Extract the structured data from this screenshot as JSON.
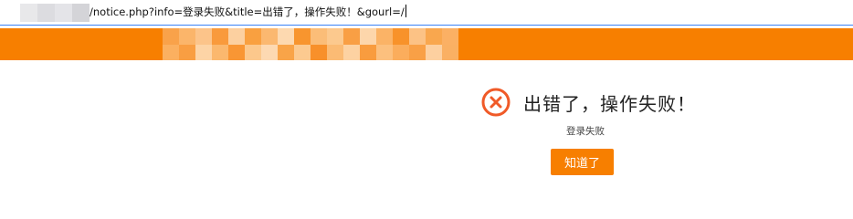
{
  "address_bar": {
    "url": "/notice.php?info=登录失败&title=出错了，操作失败！&gourl=/"
  },
  "header": {
    "background_color": "#f77f00",
    "logo": "pixelated-logo"
  },
  "notice": {
    "icon": "error-circle-x-icon",
    "icon_color": "#f05a28",
    "title": "出错了，操作失败！",
    "info": "登录失败",
    "button_label": "知道了",
    "button_color": "#f77f00"
  }
}
